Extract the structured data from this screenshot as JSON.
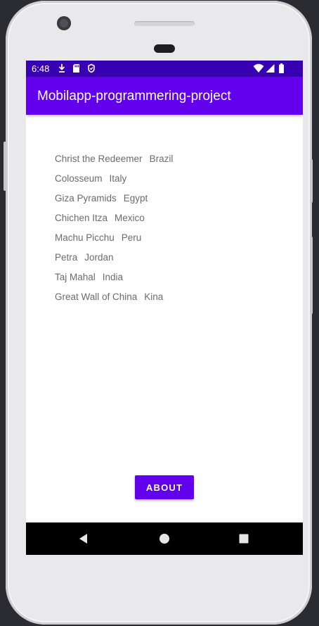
{
  "status_bar": {
    "time": "6:48",
    "left_icons": [
      "download-icon",
      "sd-card-icon",
      "vpn-icon"
    ],
    "right_icons": [
      "wifi-icon",
      "signal-icon",
      "battery-icon"
    ]
  },
  "app_bar": {
    "title": "Mobilapp-programmering-project"
  },
  "wonders": [
    {
      "name": "Christ the Redeemer",
      "country": "Brazil"
    },
    {
      "name": "Colosseum",
      "country": "Italy"
    },
    {
      "name": "Giza Pyramids",
      "country": "Egypt"
    },
    {
      "name": "Chichen Itza",
      "country": "Mexico"
    },
    {
      "name": "Machu Picchu",
      "country": "Peru"
    },
    {
      "name": "Petra",
      "country": "Jordan"
    },
    {
      "name": "Taj Mahal",
      "country": "India"
    },
    {
      "name": "Great Wall of China",
      "country": "Kina"
    }
  ],
  "about_button": {
    "label": "ABOUT"
  },
  "nav_bar": {
    "icons": [
      "back-icon",
      "home-icon",
      "recents-icon"
    ]
  },
  "colors": {
    "primary": "#6200ee",
    "primary_dark": "#3700b3",
    "list_text": "#6b6b6b"
  }
}
